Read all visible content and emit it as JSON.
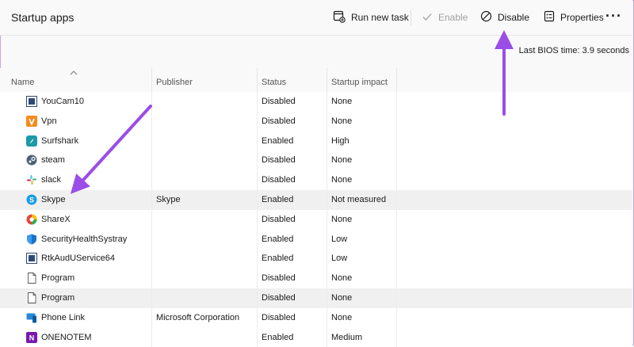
{
  "toolbar": {
    "title": "Startup apps",
    "run_new_task": "Run new task",
    "enable": "Enable",
    "disable": "Disable",
    "properties": "Properties",
    "more": "···"
  },
  "bios": {
    "label": "Last BIOS time:",
    "value": "3.9 seconds"
  },
  "columns": {
    "name": "Name",
    "publisher": "Publisher",
    "status": "Status",
    "impact": "Startup impact"
  },
  "rows": [
    {
      "name": "YouCam10",
      "publisher": "",
      "status": "Disabled",
      "impact": "None",
      "icon": "youcam-icon"
    },
    {
      "name": "Vpn",
      "publisher": "",
      "status": "Disabled",
      "impact": "None",
      "icon": "vpn-icon"
    },
    {
      "name": "Surfshark",
      "publisher": "",
      "status": "Enabled",
      "impact": "High",
      "icon": "surfshark-icon"
    },
    {
      "name": "steam",
      "publisher": "",
      "status": "Disabled",
      "impact": "None",
      "icon": "steam-icon"
    },
    {
      "name": "slack",
      "publisher": "",
      "status": "Disabled",
      "impact": "None",
      "icon": "slack-icon"
    },
    {
      "name": "Skype",
      "publisher": "Skype",
      "status": "Enabled",
      "impact": "Not measured",
      "icon": "skype-icon"
    },
    {
      "name": "ShareX",
      "publisher": "",
      "status": "Disabled",
      "impact": "None",
      "icon": "sharex-icon"
    },
    {
      "name": "SecurityHealthSystray",
      "publisher": "",
      "status": "Enabled",
      "impact": "Low",
      "icon": "shield-icon"
    },
    {
      "name": "RtkAudUService64",
      "publisher": "",
      "status": "Enabled",
      "impact": "Low",
      "icon": "realtek-icon"
    },
    {
      "name": "Program",
      "publisher": "",
      "status": "Disabled",
      "impact": "None",
      "icon": "file-icon"
    },
    {
      "name": "Program",
      "publisher": "",
      "status": "Disabled",
      "impact": "None",
      "icon": "file-icon"
    },
    {
      "name": "Phone Link",
      "publisher": "Microsoft Corporation",
      "status": "Disabled",
      "impact": "None",
      "icon": "phone-link-icon"
    },
    {
      "name": "ONENOTEM",
      "publisher": "",
      "status": "Enabled",
      "impact": "Medium",
      "icon": "onenote-icon"
    }
  ],
  "colors": {
    "annotation_arrow": "#9b4de8",
    "row_highlight": "#f0f0f0"
  }
}
